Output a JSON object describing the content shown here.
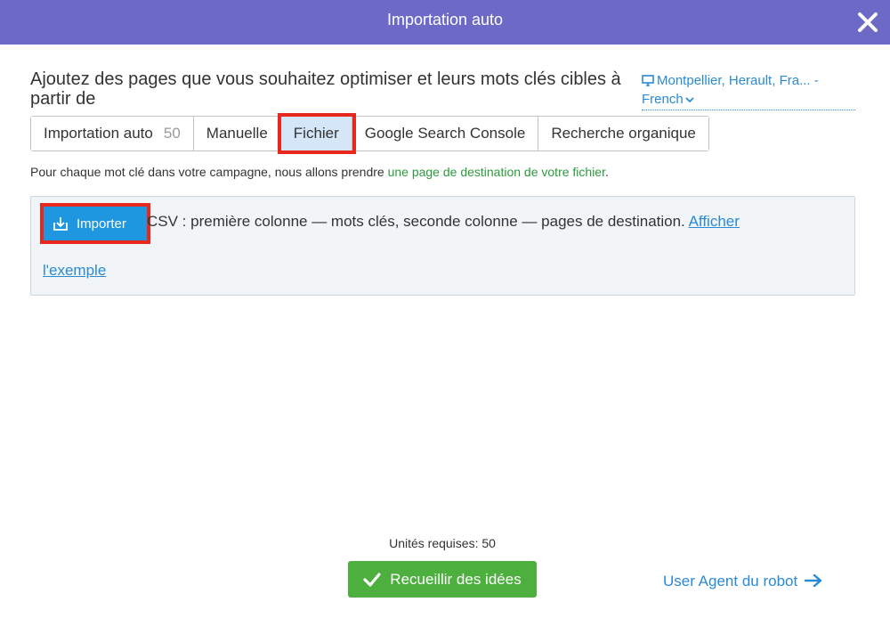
{
  "header": {
    "title": "Importation auto",
    "close_icon": "close-icon"
  },
  "heading": "Ajoutez des pages que vous souhaitez optimiser et leurs mots clés cibles à partir de",
  "location": {
    "text": "Montpellier, Herault, Fra... - French",
    "icon": "monitor-icon",
    "chevron": "chevron-down-icon"
  },
  "tabs": [
    {
      "label": "Importation auto",
      "count": "50"
    },
    {
      "label": "Manuelle"
    },
    {
      "label": "Fichier",
      "active": true
    },
    {
      "label": "Google Search Console"
    },
    {
      "label": "Recherche organique"
    }
  ],
  "description": {
    "text": "Pour chaque mot clé dans votre campagne, nous allons prendre ",
    "highlight": "une page de destination de votre fichier",
    "end": "."
  },
  "import": {
    "button_label": "Importer",
    "button_icon": "download-icon",
    "text": "CSV : première colonne — mots clés, seconde colonne — pages de destination.",
    "link_part1": "Afficher",
    "link_part2": "l'exemple"
  },
  "footer": {
    "units": "Unités requises: 50",
    "collect_label": "Recueillir des idées",
    "collect_icon": "checkmark-icon",
    "ua_link": "User Agent du robot",
    "ua_icon": "arrow-right-icon"
  },
  "colors": {
    "header": "#6c69c7",
    "link": "#2a8ad4",
    "import_button": "#1e96e0",
    "collect_button": "#4caf3e",
    "highlight_outline": "#e8281d",
    "green_text": "#2c9a3c"
  }
}
